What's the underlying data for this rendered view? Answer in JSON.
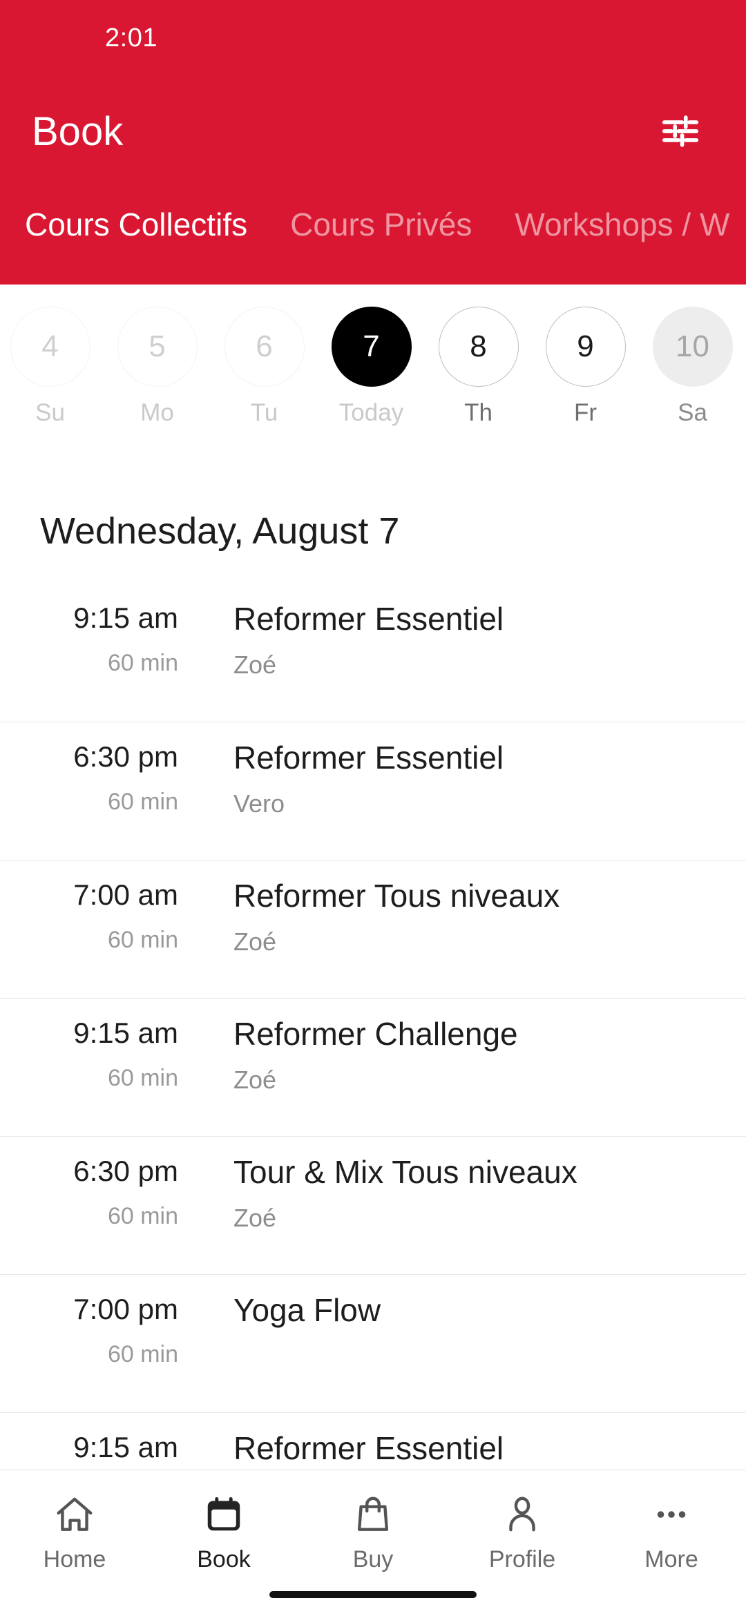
{
  "status_bar": {
    "time": "2:01"
  },
  "header": {
    "title": "Book",
    "filter_icon": "tune-sliders-icon",
    "background_color": "#d91732",
    "tabs": [
      {
        "label": "Cours Collectifs",
        "active": true
      },
      {
        "label": "Cours Privés",
        "active": false
      },
      {
        "label": "Workshops / W",
        "active": false
      }
    ]
  },
  "date_strip": {
    "days": [
      {
        "number": "4",
        "label": "Su",
        "state": "past"
      },
      {
        "number": "5",
        "label": "Mo",
        "state": "past"
      },
      {
        "number": "6",
        "label": "Tu",
        "state": "past"
      },
      {
        "number": "7",
        "label": "Today",
        "state": "selected"
      },
      {
        "number": "8",
        "label": "Th",
        "state": "future"
      },
      {
        "number": "9",
        "label": "Fr",
        "state": "future"
      },
      {
        "number": "10",
        "label": "Sa",
        "state": "pressed"
      }
    ]
  },
  "schedule": {
    "day_heading": "Wednesday, August 7",
    "classes": [
      {
        "time": "9:15 am",
        "duration": "60 min",
        "name": "Reformer Essentiel",
        "instructor": "Zoé"
      },
      {
        "time": "6:30 pm",
        "duration": "60 min",
        "name": "Reformer Essentiel",
        "instructor": "Vero"
      },
      {
        "time": "7:00 am",
        "duration": "60 min",
        "name": "Reformer Tous niveaux",
        "instructor": "Zoé"
      },
      {
        "time": "9:15 am",
        "duration": "60 min",
        "name": "Reformer Challenge",
        "instructor": "Zoé"
      },
      {
        "time": "6:30 pm",
        "duration": "60 min",
        "name": "Tour & Mix Tous niveaux",
        "instructor": "Zoé"
      },
      {
        "time": "7:00 pm",
        "duration": "60 min",
        "name": "Yoga Flow",
        "instructor": ""
      },
      {
        "time": "9:15 am",
        "duration": "",
        "name": "Reformer Essentiel",
        "instructor": ""
      }
    ]
  },
  "bottom_nav": {
    "items": [
      {
        "label": "Home",
        "icon": "home-icon",
        "active": false
      },
      {
        "label": "Book",
        "icon": "calendar-icon",
        "active": true
      },
      {
        "label": "Buy",
        "icon": "bag-icon",
        "active": false
      },
      {
        "label": "Profile",
        "icon": "person-icon",
        "active": false
      },
      {
        "label": "More",
        "icon": "ellipsis-icon",
        "active": false
      }
    ]
  }
}
